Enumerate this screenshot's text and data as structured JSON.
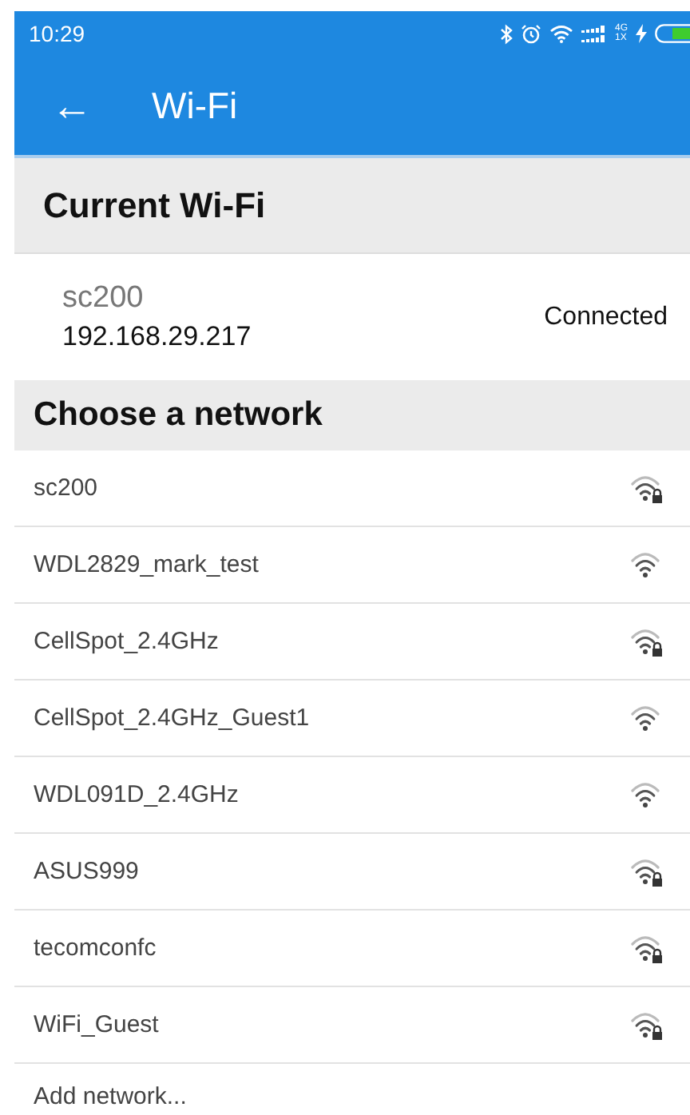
{
  "status_bar": {
    "time": "10:29",
    "network_top": "4G",
    "network_bottom": "1X"
  },
  "app_bar": {
    "back": "←",
    "title": "Wi-Fi"
  },
  "current_section": {
    "title": "Current Wi-Fi",
    "network": {
      "name": "sc200",
      "ip": "192.168.29.217",
      "status": "Connected"
    }
  },
  "networks_section": {
    "title": "Choose a network",
    "networks": [
      {
        "name": "sc200",
        "secured": true
      },
      {
        "name": "WDL2829_mark_test",
        "secured": false
      },
      {
        "name": "CellSpot_2.4GHz",
        "secured": true
      },
      {
        "name": "CellSpot_2.4GHz_Guest1",
        "secured": false
      },
      {
        "name": "WDL091D_2.4GHz",
        "secured": false
      },
      {
        "name": "ASUS999",
        "secured": true
      },
      {
        "name": "tecomconfc",
        "secured": true
      },
      {
        "name": "WiFi_Guest",
        "secured": true
      }
    ],
    "add_network": "Add network..."
  }
}
